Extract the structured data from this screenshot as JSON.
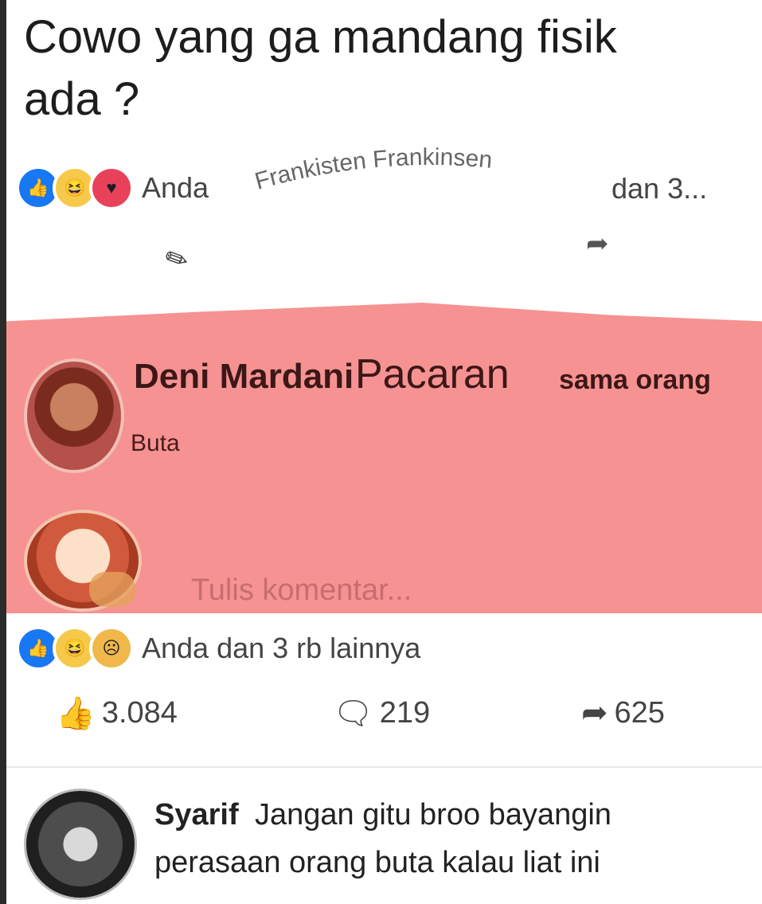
{
  "post": {
    "title_line1": "Cowo yang ga mandang fisik",
    "title_line2": "ada ?"
  },
  "reactions_top": {
    "icons": [
      "like-icon",
      "haha-icon",
      "love-icon"
    ],
    "you_label": "Anda",
    "curved_name": "Frankisten Frankinsen",
    "suffix": "dan 3..."
  },
  "comment_top": {
    "author": "Deni Mardani",
    "text_main": "Pacaran",
    "text_tail": "sama orang",
    "text_line2": "Buta"
  },
  "comment_input": {
    "placeholder": "Tulis komentar..."
  },
  "reactions_bottom": {
    "icons": [
      "like-icon",
      "haha-icon",
      "sad-icon"
    ],
    "label": "Anda dan 3 rb lainnya"
  },
  "actions": {
    "like_count": "3.084",
    "comment_count": "219",
    "share_count": "625"
  },
  "reply": {
    "author": "Syarif",
    "text_line1": "Jangan gitu broo bayangin",
    "text_line2": "perasaan orang buta kalau liat ini"
  }
}
